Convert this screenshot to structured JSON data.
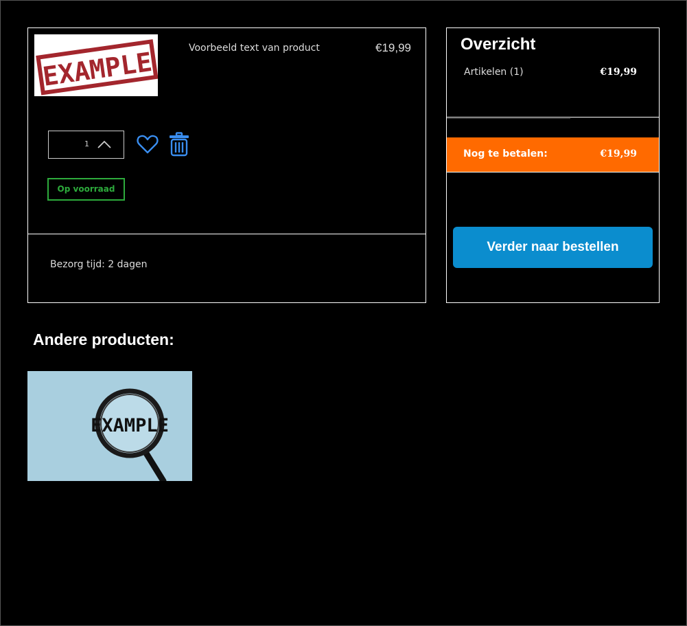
{
  "cart": {
    "product": {
      "image_text": "EXAMPLE",
      "name": "Voorbeeld text van product",
      "price": "€19,99",
      "quantity": "1",
      "stock_status": "Op voorraad"
    },
    "delivery": "Bezorg tijd: 2 dagen"
  },
  "summary": {
    "title": "Overzicht",
    "items_label": "Artikelen (1)",
    "items_price": "€19,99",
    "pay_label": "Nog te betalen:",
    "pay_price": "€19,99",
    "order_button": "Verder naar bestellen"
  },
  "related": {
    "title": "Andere producten:",
    "items": [
      {
        "image_text": "EXAMPLE"
      }
    ]
  },
  "icons": {
    "quantity": "chevron-up-icon",
    "favorite": "heart-icon",
    "delete": "trash-icon"
  },
  "colors": {
    "background": "#000000",
    "accent": "#ff6a00",
    "button": "#0b8dce",
    "in_stock": "#2dab3c",
    "icon_blue": "#3a8ef0"
  }
}
